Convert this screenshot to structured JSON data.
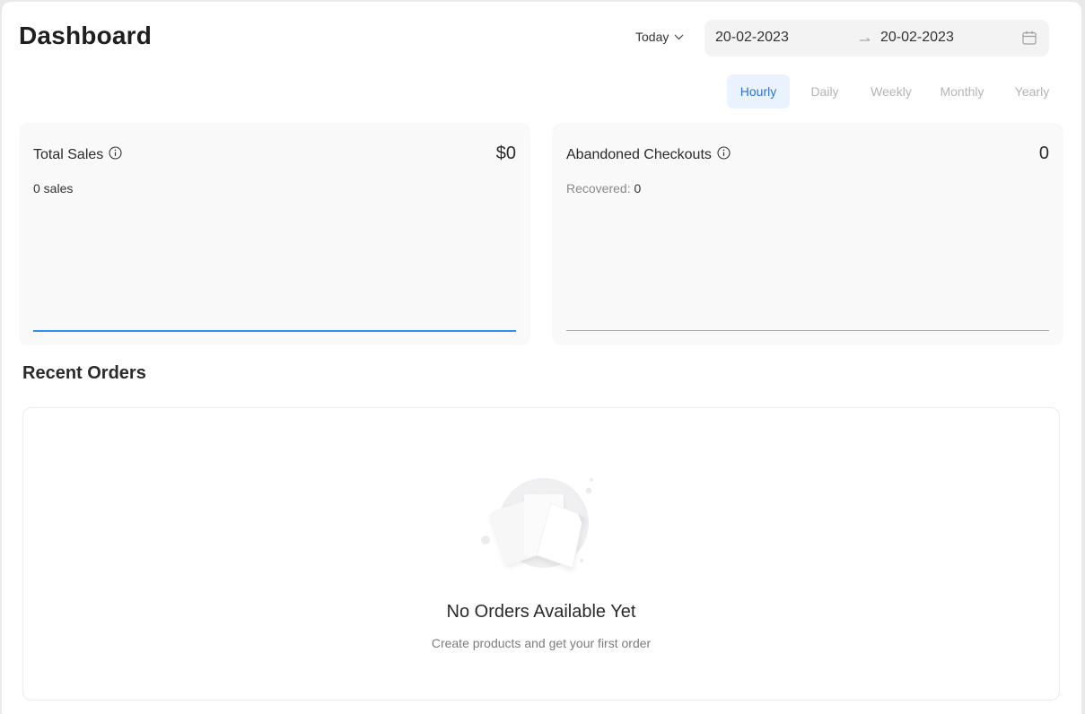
{
  "header": {
    "title": "Dashboard",
    "range_select": "Today",
    "date_start": "20-02-2023",
    "date_end": "20-02-2023"
  },
  "granularity": {
    "options": [
      "Hourly",
      "Daily",
      "Weekly",
      "Monthly",
      "Yearly"
    ],
    "selected": "Hourly"
  },
  "cards": {
    "total_sales": {
      "title": "Total Sales",
      "value": "$0",
      "sub": "0 sales"
    },
    "abandoned": {
      "title": "Abandoned Checkouts",
      "value": "0",
      "sub_label": "Recovered:",
      "sub_value": "0"
    }
  },
  "recent_orders": {
    "title": "Recent Orders",
    "empty_title": "No Orders Available Yet",
    "empty_subtitle": "Create products and get your first order"
  },
  "colors": {
    "accent": "#2f6fd6",
    "active_tab_bg": "#eaf3fd",
    "sales_line": "#2f8eea",
    "card_bg": "#f9f9f9"
  },
  "icons": {
    "range_select": "chevron-down-icon",
    "date_separator": "arrow-right-icon",
    "calendar": "calendar-icon",
    "info": "info-icon",
    "empty_state": "empty-documents-illustration"
  }
}
